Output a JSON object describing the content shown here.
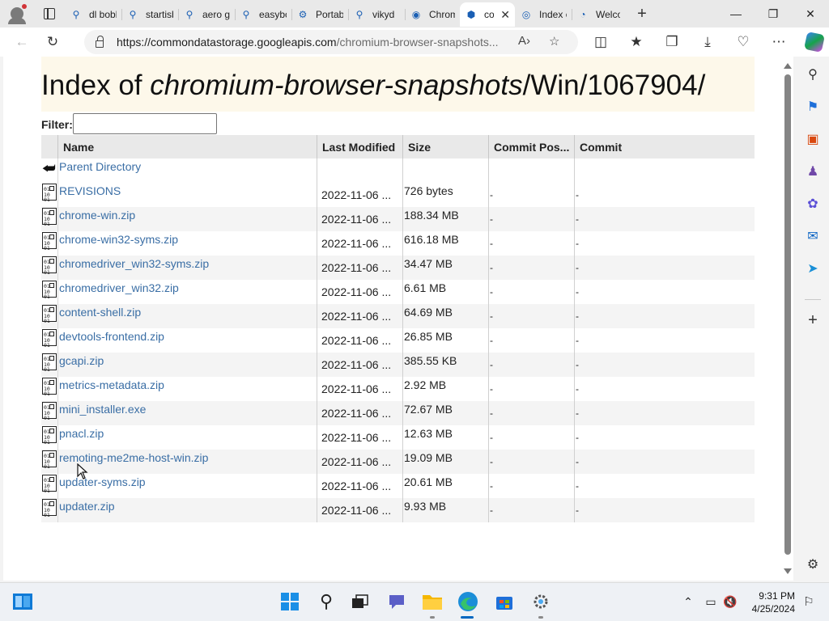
{
  "tabs": [
    {
      "label": "dl bobby",
      "icon": "search-icon",
      "active": false
    },
    {
      "label": "startisback",
      "icon": "search-icon",
      "active": false
    },
    {
      "label": "aero glass",
      "icon": "search-icon",
      "active": false
    },
    {
      "label": "easybcd",
      "icon": "search-icon",
      "active": false
    },
    {
      "label": "Portable",
      "icon": "portable-icon",
      "active": false
    },
    {
      "label": "vikyd",
      "icon": "search-icon",
      "active": false
    },
    {
      "label": "Chrom",
      "icon": "chromium-icon",
      "active": false
    },
    {
      "label": "co",
      "icon": "storage-icon",
      "active": true
    },
    {
      "label": "Index c",
      "icon": "index-icon",
      "active": false
    },
    {
      "label": "Welco",
      "icon": "edge-icon",
      "active": false
    }
  ],
  "address": {
    "host": "https://commondatastorage.googleapis.com",
    "path": "/chromium-browser-snapshots..."
  },
  "page": {
    "title_prefix": "Index of ",
    "title_italic": "chromium-browser-snapshots",
    "title_suffix": "/Win/1067904/",
    "filter_label": "Filter:",
    "filter_value": ""
  },
  "table": {
    "headers": {
      "name": "Name",
      "modified": "Last Modified",
      "size": "Size",
      "commit_pos": "Commit Pos...",
      "commit": "Commit"
    },
    "parent": "Parent Directory",
    "rows": [
      {
        "name": "REVISIONS",
        "modified": "2022-11-06 ...",
        "size": "726 bytes",
        "commit_pos": "-",
        "commit": "-"
      },
      {
        "name": "chrome-win.zip",
        "modified": "2022-11-06 ...",
        "size": "188.34 MB",
        "commit_pos": "-",
        "commit": "-"
      },
      {
        "name": "chrome-win32-syms.zip",
        "modified": "2022-11-06 ...",
        "size": "616.18 MB",
        "commit_pos": "-",
        "commit": "-"
      },
      {
        "name": "chromedriver_win32-syms.zip",
        "modified": "2022-11-06 ...",
        "size": "34.47 MB",
        "commit_pos": "-",
        "commit": "-"
      },
      {
        "name": "chromedriver_win32.zip",
        "modified": "2022-11-06 ...",
        "size": "6.61 MB",
        "commit_pos": "-",
        "commit": "-"
      },
      {
        "name": "content-shell.zip",
        "modified": "2022-11-06 ...",
        "size": "64.69 MB",
        "commit_pos": "-",
        "commit": "-"
      },
      {
        "name": "devtools-frontend.zip",
        "modified": "2022-11-06 ...",
        "size": "26.85 MB",
        "commit_pos": "-",
        "commit": "-"
      },
      {
        "name": "gcapi.zip",
        "modified": "2022-11-06 ...",
        "size": "385.55 KB",
        "commit_pos": "-",
        "commit": "-"
      },
      {
        "name": "metrics-metadata.zip",
        "modified": "2022-11-06 ...",
        "size": "2.92 MB",
        "commit_pos": "-",
        "commit": "-"
      },
      {
        "name": "mini_installer.exe",
        "modified": "2022-11-06 ...",
        "size": "72.67 MB",
        "commit_pos": "-",
        "commit": "-"
      },
      {
        "name": "pnacl.zip",
        "modified": "2022-11-06 ...",
        "size": "12.63 MB",
        "commit_pos": "-",
        "commit": "-"
      },
      {
        "name": "remoting-me2me-host-win.zip",
        "modified": "2022-11-06 ...",
        "size": "19.09 MB",
        "commit_pos": "-",
        "commit": "-"
      },
      {
        "name": "updater-syms.zip",
        "modified": "2022-11-06 ...",
        "size": "20.61 MB",
        "commit_pos": "-",
        "commit": "-"
      },
      {
        "name": "updater.zip",
        "modified": "2022-11-06 ...",
        "size": "9.93 MB",
        "commit_pos": "-",
        "commit": "-"
      }
    ]
  },
  "file_icon_text": "01\n10\n01",
  "taskbar": {
    "time": "9:31 PM",
    "date": "4/25/2024"
  },
  "colors": {
    "link": "#3a6ea5",
    "header_band": "#fdf8ea",
    "accent": "#0067c0"
  }
}
